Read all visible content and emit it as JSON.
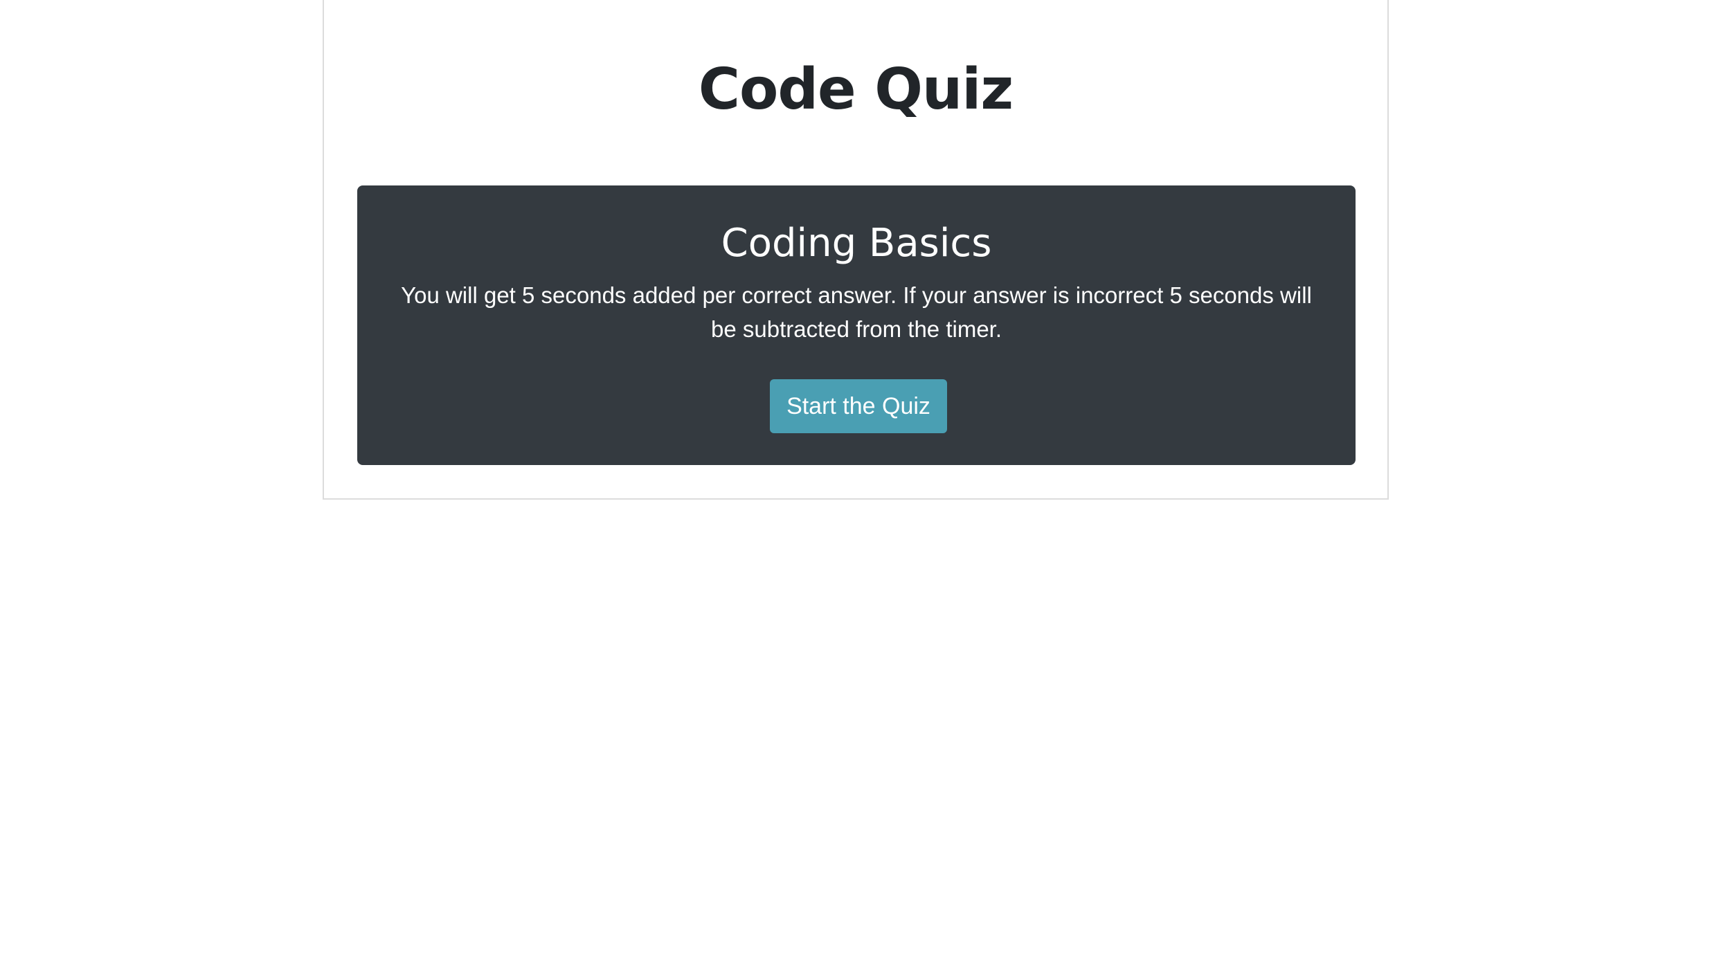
{
  "header": {
    "title": "Code Quiz"
  },
  "intro_card": {
    "title": "Coding Basics",
    "description": "You will get 5 seconds added per correct answer. If your answer is incorrect 5 seconds will be subtracted from the timer.",
    "start_button_label": "Start the Quiz"
  },
  "colors": {
    "card_background": "#343a40",
    "button_background": "#4a9fb3",
    "title_text": "#212529"
  }
}
